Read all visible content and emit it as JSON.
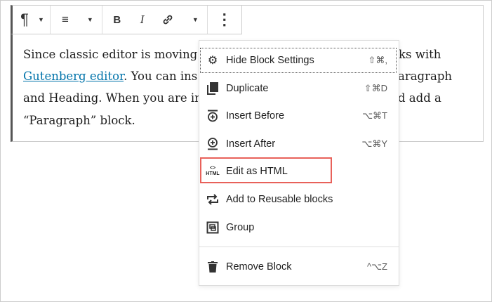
{
  "toolbar": {
    "paragraph": "¶",
    "align": "≡",
    "bold": "B",
    "italic": "I",
    "link": "🔗",
    "more": "⋮"
  },
  "content": {
    "line1_left": "Since classic editor is moving",
    "line1_right": "ks with",
    "line2_link": "Gutenberg editor",
    "line2_left": ". You can ins",
    "line2_right": "aragraph",
    "line3_left": "and Heading. When you are in",
    "line3_right": "d add a",
    "line4": "“Paragraph” block."
  },
  "menu": {
    "items": [
      {
        "label": "Hide Block Settings",
        "shortcut": "⇧⌘,",
        "icon": "gear-icon"
      },
      {
        "label": "Duplicate",
        "shortcut": "⇧⌘D",
        "icon": "duplicate-icon"
      },
      {
        "label": "Insert Before",
        "shortcut": "⌥⌘T",
        "icon": "insert-before-icon"
      },
      {
        "label": "Insert After",
        "shortcut": "⌥⌘Y",
        "icon": "insert-after-icon"
      },
      {
        "label": "Edit as HTML",
        "shortcut": "",
        "icon": "html-icon"
      },
      {
        "label": "Add to Reusable blocks",
        "shortcut": "",
        "icon": "reusable-icon"
      },
      {
        "label": "Group",
        "shortcut": "",
        "icon": "group-icon"
      },
      {
        "label": "Remove Block",
        "shortcut": "^⌥Z",
        "icon": "trash-icon"
      }
    ]
  },
  "colors": {
    "highlight": "#e8615a",
    "link": "#0073aa"
  }
}
